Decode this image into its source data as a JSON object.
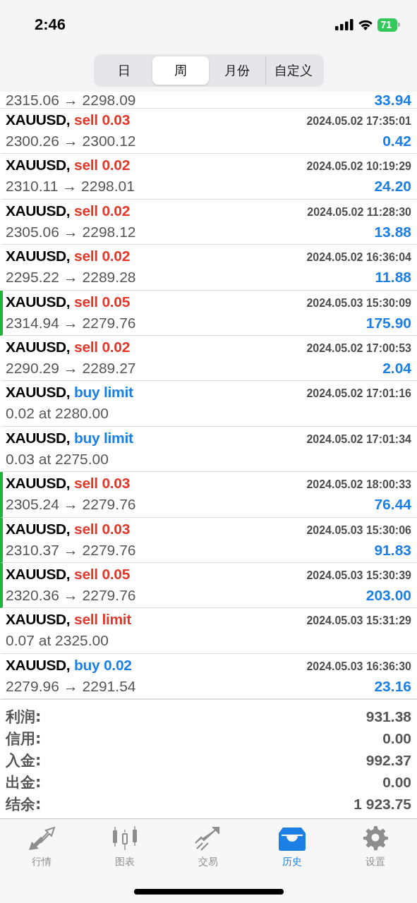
{
  "status_bar": {
    "time": "2:46",
    "battery": "71"
  },
  "period_tabs": [
    {
      "label": "日",
      "selected": false
    },
    {
      "label": "周",
      "selected": true
    },
    {
      "label": "月份",
      "selected": false
    },
    {
      "label": "自定义",
      "selected": false
    }
  ],
  "partial_row": {
    "prices": "2315.06 → 2298.09",
    "profit": "33.94"
  },
  "deals": [
    {
      "symbol": "XAUUSD,",
      "side": "sell 0.03",
      "kind": "sell",
      "time": "2024.05.02 17:35:01",
      "detail": "2300.26 → 2300.12",
      "profit": "0.42",
      "marked": false
    },
    {
      "symbol": "XAUUSD,",
      "side": "sell 0.02",
      "kind": "sell",
      "time": "2024.05.02 10:19:29",
      "detail": "2310.11 → 2298.01",
      "profit": "24.20",
      "marked": false
    },
    {
      "symbol": "XAUUSD,",
      "side": "sell 0.02",
      "kind": "sell",
      "time": "2024.05.02 11:28:30",
      "detail": "2305.06 → 2298.12",
      "profit": "13.88",
      "marked": false
    },
    {
      "symbol": "XAUUSD,",
      "side": "sell 0.02",
      "kind": "sell",
      "time": "2024.05.02 16:36:04",
      "detail": "2295.22 → 2289.28",
      "profit": "11.88",
      "marked": false
    },
    {
      "symbol": "XAUUSD,",
      "side": "sell 0.05",
      "kind": "sell",
      "time": "2024.05.03 15:30:09",
      "detail": "2314.94 → 2279.76",
      "profit": "175.90",
      "marked": true
    },
    {
      "symbol": "XAUUSD,",
      "side": "sell 0.02",
      "kind": "sell",
      "time": "2024.05.02 17:00:53",
      "detail": "2290.29 → 2289.27",
      "profit": "2.04",
      "marked": false
    },
    {
      "symbol": "XAUUSD,",
      "side": "buy limit",
      "kind": "buy",
      "time": "2024.05.02 17:01:16",
      "detail": "0.02 at 2280.00",
      "marked": false
    },
    {
      "symbol": "XAUUSD,",
      "side": "buy limit",
      "kind": "buy",
      "time": "2024.05.02 17:01:34",
      "detail": "0.03 at 2275.00",
      "marked": false
    },
    {
      "symbol": "XAUUSD,",
      "side": "sell 0.03",
      "kind": "sell",
      "time": "2024.05.02 18:00:33",
      "detail": "2305.24 → 2279.76",
      "profit": "76.44",
      "marked": true
    },
    {
      "symbol": "XAUUSD,",
      "side": "sell 0.03",
      "kind": "sell",
      "time": "2024.05.03 15:30:06",
      "detail": "2310.37 → 2279.76",
      "profit": "91.83",
      "marked": true
    },
    {
      "symbol": "XAUUSD,",
      "side": "sell 0.05",
      "kind": "sell",
      "time": "2024.05.03 15:30:39",
      "detail": "2320.36 → 2279.76",
      "profit": "203.00",
      "marked": true
    },
    {
      "symbol": "XAUUSD,",
      "side": "sell limit",
      "kind": "sell",
      "time": "2024.05.03 15:31:29",
      "detail": "0.07 at 2325.00",
      "marked": false
    },
    {
      "symbol": "XAUUSD,",
      "side": "buy 0.02",
      "kind": "buy",
      "time": "2024.05.03 16:36:30",
      "detail": "2279.96 → 2291.54",
      "profit": "23.16",
      "marked": false
    }
  ],
  "summary": [
    {
      "label": "利润:",
      "value": "931.38"
    },
    {
      "label": "信用:",
      "value": "0.00"
    },
    {
      "label": "入金:",
      "value": "992.37"
    },
    {
      "label": "出金:",
      "value": "0.00"
    },
    {
      "label": "结余:",
      "value": "1 923.75"
    }
  ],
  "bottom_tabs": [
    {
      "label": "行情",
      "kind": "quotes",
      "selected": false
    },
    {
      "label": "图表",
      "kind": "chart",
      "selected": false
    },
    {
      "label": "交易",
      "kind": "trade",
      "selected": false
    },
    {
      "label": "历史",
      "kind": "history",
      "selected": true
    },
    {
      "label": "设置",
      "kind": "settings",
      "selected": false
    }
  ]
}
